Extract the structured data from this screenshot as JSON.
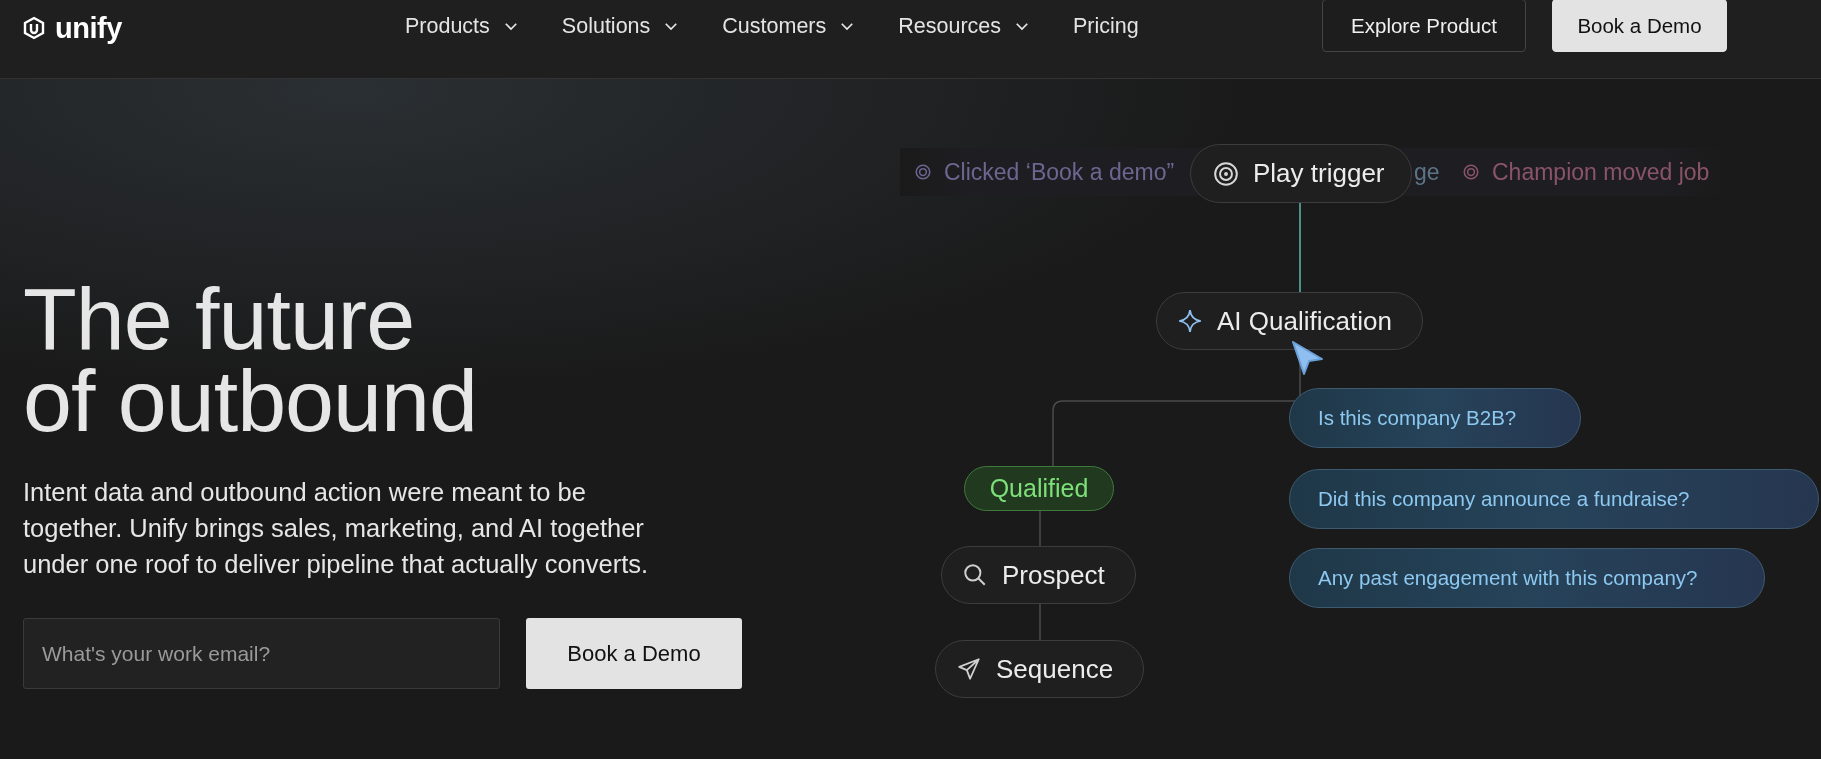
{
  "nav": {
    "logo": "unify",
    "items": [
      {
        "label": "Products",
        "dropdown": true
      },
      {
        "label": "Solutions",
        "dropdown": true
      },
      {
        "label": "Customers",
        "dropdown": true
      },
      {
        "label": "Resources",
        "dropdown": true
      },
      {
        "label": "Pricing",
        "dropdown": false
      }
    ],
    "buttons": [
      {
        "label": "Explore Product",
        "kind": "outline"
      },
      {
        "label": "Book a Demo",
        "kind": "filled"
      }
    ]
  },
  "hero": {
    "heading": [
      "The future",
      "of outbound"
    ],
    "paragraph": "Intent data and outbound action were meant to be together. Unify brings sales, marketing, and AI together under one roof to deliver pipeline that actually converts.",
    "email": {
      "placeholder": "What's your work email?"
    },
    "button": "Book a Demo"
  },
  "diagram": {
    "events": [
      {
        "label": "Clicked ‘Book a demo”",
        "kind": "event",
        "color": "#6c6690"
      },
      {
        "label": "ge",
        "kind": "fragment",
        "color": "#5d7487"
      },
      {
        "label": "Champion moved job",
        "kind": "event",
        "color": "#8a5468"
      }
    ],
    "nodes": [
      {
        "label": "Play trigger",
        "kind": "trigger"
      },
      {
        "label": "AI Qualification",
        "kind": "ai"
      },
      {
        "label": "Qualified",
        "kind": "status"
      },
      {
        "label": "Prospect",
        "kind": "prospect"
      },
      {
        "label": "Sequence",
        "kind": "sequence"
      }
    ],
    "questions": [
      "Is this company B2B?",
      "Did this company announce a fundraise?",
      "Any past engagement with this company?"
    ]
  }
}
